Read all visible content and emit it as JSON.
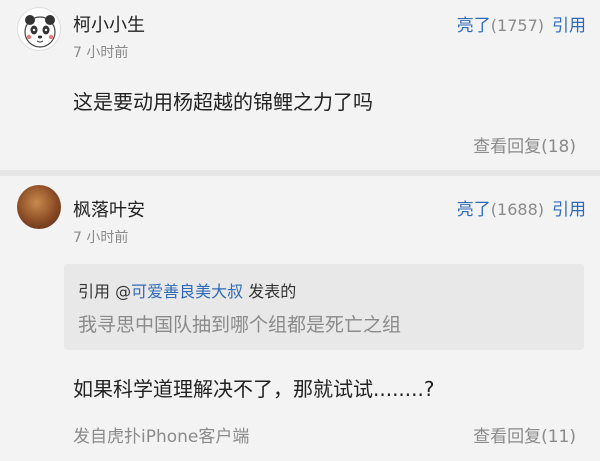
{
  "comments": [
    {
      "username": "柯小小生",
      "time": "7 小时前",
      "like_label": "亮了",
      "like_count": "(1757)",
      "quote_label": "引用",
      "text": "这是要动用杨超越的锦鲤之力了吗",
      "replies_label": "查看回复",
      "replies_count": "(18)"
    },
    {
      "username": "枫落叶安",
      "time": "7 小时前",
      "like_label": "亮了",
      "like_count": "(1688)",
      "quote_label": "引用",
      "quote": {
        "prefix": "引用 @",
        "user": "可爱善良美大叔",
        "suffix": " 发表的",
        "text": "我寻思中国队抽到哪个组都是死亡之组"
      },
      "text": "如果科学道理解决不了，那就试试........?",
      "source": "发自虎扑iPhone客户端",
      "replies_label": "查看回复",
      "replies_count": "(11)"
    }
  ]
}
